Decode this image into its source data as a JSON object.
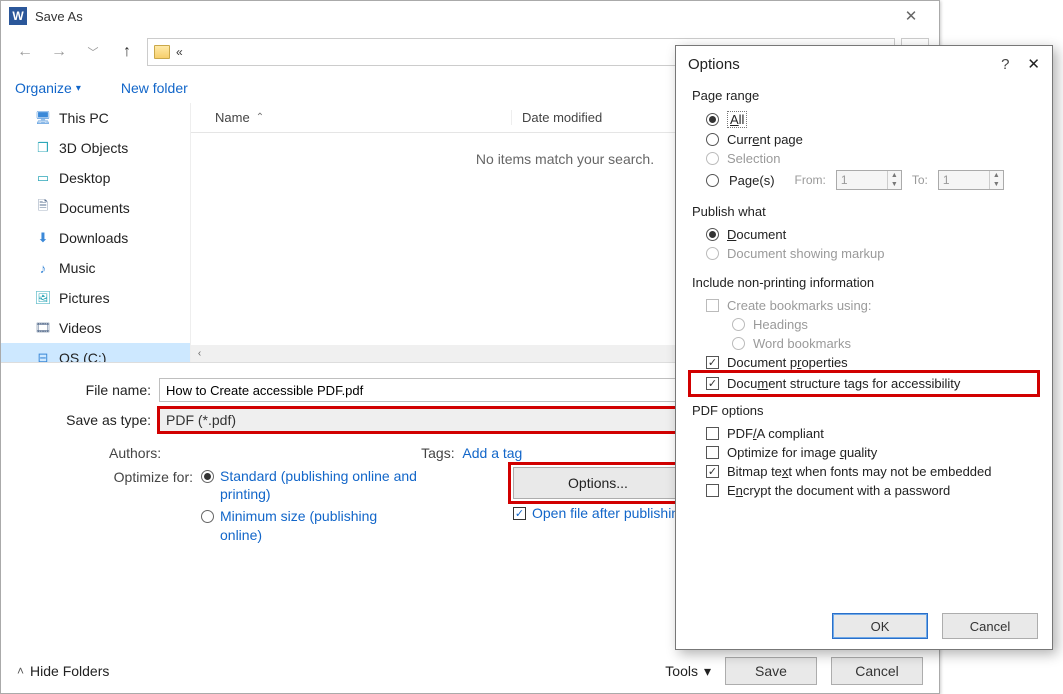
{
  "saveas": {
    "title": "Save As",
    "address_path": "«",
    "toolbar": {
      "organize": "Organize",
      "new_folder": "New folder"
    },
    "sidebar": {
      "items": [
        {
          "label": "This PC"
        },
        {
          "label": "3D Objects"
        },
        {
          "label": "Desktop"
        },
        {
          "label": "Documents"
        },
        {
          "label": "Downloads"
        },
        {
          "label": "Music"
        },
        {
          "label": "Pictures"
        },
        {
          "label": "Videos"
        },
        {
          "label": "OS (C:)"
        }
      ]
    },
    "list": {
      "col_name": "Name",
      "col_date": "Date modified",
      "empty": "No items match your search."
    },
    "filename_label": "File name:",
    "filename_value": "How to Create accessible PDF.pdf",
    "savetype_label": "Save as type:",
    "savetype_value": "PDF (*.pdf)",
    "authors_label": "Authors:",
    "tags_label": "Tags:",
    "tags_link": "Add a tag",
    "optimize_label": "Optimize for:",
    "opt_standard": "Standard (publishing online and printing)",
    "opt_minimum": "Minimum size (publishing online)",
    "options_btn": "Options...",
    "open_after": "Open file after publishing",
    "hide_folders": "Hide Folders",
    "tools": "Tools",
    "save": "Save",
    "cancel": "Cancel"
  },
  "options": {
    "title": "Options",
    "page_range": "Page range",
    "all": "All",
    "current_page": "Current page",
    "selection": "Selection",
    "pages": "Page(s)",
    "from": "From:",
    "to": "To:",
    "from_val": "1",
    "to_val": "1",
    "publish_what": "Publish what",
    "document": "Document",
    "doc_markup": "Document showing markup",
    "include_np": "Include non-printing information",
    "create_bm": "Create bookmarks using:",
    "headings": "Headings",
    "word_bm": "Word bookmarks",
    "doc_props": "Document properties",
    "doc_struct": "Document structure tags for accessibility",
    "pdf_options": "PDF options",
    "pdfa": "PDF/A compliant",
    "opt_image": "Optimize for image quality",
    "bitmap": "Bitmap text when fonts may not be embedded",
    "encrypt": "Encrypt the document with a password",
    "ok": "OK",
    "cancel": "Cancel"
  }
}
